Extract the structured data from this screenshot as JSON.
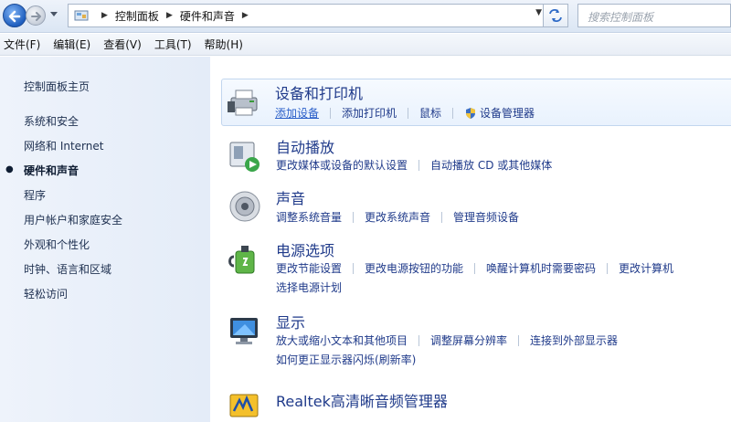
{
  "address": {
    "breadcrumbs": [
      "控制面板",
      "硬件和声音"
    ],
    "search_placeholder": "搜索控制面板"
  },
  "menu": [
    "文件(F)",
    "编辑(E)",
    "查看(V)",
    "工具(T)",
    "帮助(H)"
  ],
  "sidebar": {
    "home": "控制面板主页",
    "items": [
      "系统和安全",
      "网络和 Internet",
      "硬件和声音",
      "程序",
      "用户帐户和家庭安全",
      "外观和个性化",
      "时钟、语言和区域",
      "轻松访问"
    ],
    "current_index": 2
  },
  "categories": [
    {
      "title": "设备和打印机",
      "icon": "printer-icon",
      "rows": [
        [
          "添加设备",
          "添加打印机",
          "鼠标",
          "设备管理器"
        ]
      ]
    },
    {
      "title": "自动播放",
      "icon": "autoplay-icon",
      "rows": [
        [
          "更改媒体或设备的默认设置",
          "自动播放 CD 或其他媒体"
        ]
      ]
    },
    {
      "title": "声音",
      "icon": "speaker-icon",
      "rows": [
        [
          "调整系统音量",
          "更改系统声音",
          "管理音频设备"
        ]
      ]
    },
    {
      "title": "电源选项",
      "icon": "power-icon",
      "rows": [
        [
          "更改节能设置",
          "更改电源按钮的功能",
          "唤醒计算机时需要密码",
          "更改计算机"
        ],
        [
          "选择电源计划"
        ]
      ]
    },
    {
      "title": "显示",
      "icon": "display-icon",
      "rows": [
        [
          "放大或缩小文本和其他项目",
          "调整屏幕分辨率",
          "连接到外部显示器"
        ],
        [
          "如何更正显示器闪烁(刷新率)"
        ]
      ]
    },
    {
      "title": "Realtek高清晰音频管理器",
      "icon": "realtek-icon",
      "rows": []
    }
  ]
}
